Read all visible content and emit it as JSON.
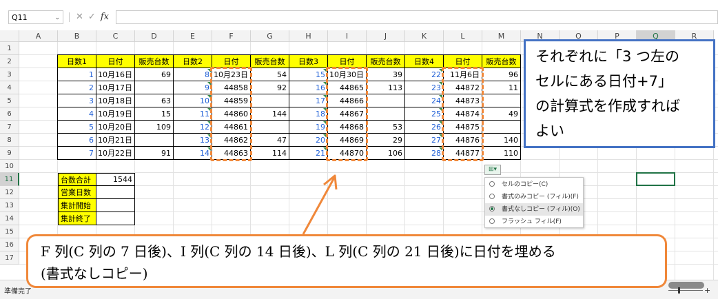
{
  "formula_bar": {
    "name_box": "Q11",
    "cancel_symbol": "✕",
    "enter_symbol": "✓",
    "fx_label": "fx",
    "formula": ""
  },
  "columns": [
    "A",
    "B",
    "C",
    "D",
    "E",
    "F",
    "G",
    "H",
    "I",
    "J",
    "K",
    "L",
    "M",
    "N",
    "O",
    "P",
    "Q",
    "R"
  ],
  "selected_column": "Q",
  "rows": [
    "1",
    "2",
    "3",
    "4",
    "5",
    "6",
    "7",
    "8",
    "9",
    "10",
    "11",
    "12",
    "13",
    "14",
    "15",
    "16",
    "17"
  ],
  "selected_row": "11",
  "table": {
    "headers": [
      "日数1",
      "日付",
      "販売台数",
      "日数2",
      "日付",
      "販売台数",
      "日数3",
      "日付",
      "販売台数",
      "日数4",
      "日付",
      "販売台数"
    ],
    "rows": [
      [
        "1",
        "10月16日",
        "69",
        "8",
        "10月23日",
        "54",
        "15",
        "10月30日",
        "39",
        "22",
        "11月6日",
        "96"
      ],
      [
        "2",
        "10月17日",
        "",
        "9",
        "44858",
        "92",
        "16",
        "44865",
        "113",
        "23",
        "44872",
        "11"
      ],
      [
        "3",
        "10月18日",
        "63",
        "10",
        "44859",
        "",
        "17",
        "44866",
        "",
        "24",
        "44873",
        ""
      ],
      [
        "4",
        "10月19日",
        "15",
        "11",
        "44860",
        "144",
        "18",
        "44867",
        "",
        "25",
        "44874",
        "49"
      ],
      [
        "5",
        "10月20日",
        "109",
        "12",
        "44861",
        "",
        "19",
        "44868",
        "53",
        "26",
        "44875",
        ""
      ],
      [
        "6",
        "10月21日",
        "",
        "13",
        "44862",
        "47",
        "20",
        "44869",
        "29",
        "27",
        "44876",
        "140"
      ],
      [
        "7",
        "10月22日",
        "91",
        "14",
        "44863",
        "114",
        "21",
        "44870",
        "106",
        "28",
        "44877",
        "110"
      ]
    ]
  },
  "summary": [
    {
      "label": "台数合計",
      "value": "1544"
    },
    {
      "label": "営業日数",
      "value": ""
    },
    {
      "label": "集計開始",
      "value": ""
    },
    {
      "label": "集計終了",
      "value": ""
    }
  ],
  "autofill_menu": {
    "button_label": "⊞▾",
    "items": [
      {
        "label": "セルのコピー(C)",
        "selected": false
      },
      {
        "label": "書式のみコピー (フィル)(F)",
        "selected": false
      },
      {
        "label": "書式なしコピー (フィル)(O)",
        "selected": true
      },
      {
        "label": "フラッシュ フィル(F)",
        "selected": false
      }
    ]
  },
  "callouts": {
    "right": [
      "それぞれに「3 つ左の",
      "セルにある日付+7」",
      "の計算式を作成すれば",
      "よい"
    ],
    "bottom": [
      "F 列(C 列の 7 日後)、I 列(C 列の 14 日後)、L 列(C 列の 21 日後)に日付を埋める",
      "(書式なしコピー)"
    ]
  },
  "status_bar": {
    "text": "準備完了"
  },
  "colors": {
    "header_fill": "#ffff00",
    "blue_text": "#1f5fd6",
    "dash_orange": "#f0883a",
    "callout_blue": "#4472c4",
    "excel_green": "#217346"
  }
}
